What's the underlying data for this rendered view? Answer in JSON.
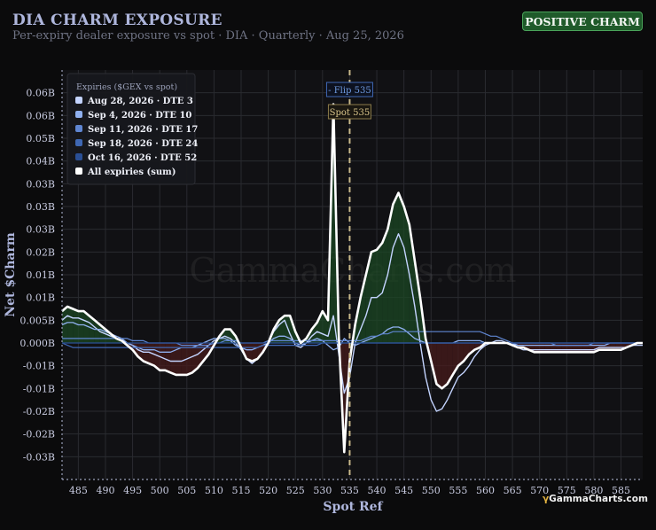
{
  "header": {
    "title": "DIA CHARM EXPOSURE",
    "subtitle": "Per-expiry dealer exposure vs spot · DIA · Quarterly · Aug 25, 2026",
    "badge": "POSITIVE CHARM"
  },
  "watermark": "GammaCharts.com",
  "brand": "GammaCharts.com",
  "colors": {
    "background": "#0b0b0c",
    "sum_line": "#ffffff",
    "positive_fill": "#1b4a24",
    "negative_fill": "#4a1b1b",
    "spot_line": "#c9b98a",
    "flip_label": "#6f9be0",
    "badge_bg": "#1f5a2a"
  },
  "chart_data": {
    "type": "line",
    "title": "DIA CHARM EXPOSURE",
    "xlabel": "Spot Ref",
    "ylabel": "Net $Charm",
    "xlim": [
      482,
      589
    ],
    "ylim": [
      -0.06,
      0.12
    ],
    "grid": true,
    "legend_title": "Expiries ($GEX vs spot)",
    "legend_position": "top-left",
    "x_ticks": [
      485,
      490,
      495,
      500,
      505,
      510,
      515,
      520,
      525,
      530,
      535,
      540,
      545,
      550,
      555,
      560,
      565,
      570,
      575,
      580,
      585
    ],
    "y_ticks": [
      {
        "v": -0.05,
        "label": "-0.03B"
      },
      {
        "v": -0.04,
        "label": "-0.02B"
      },
      {
        "v": -0.03,
        "label": "-0.02B"
      },
      {
        "v": -0.02,
        "label": "-0.01B"
      },
      {
        "v": -0.01,
        "label": "-0.01B"
      },
      {
        "v": 0.0,
        "label": "0.000B"
      },
      {
        "v": 0.01,
        "label": "0.005B"
      },
      {
        "v": 0.02,
        "label": "0.01B"
      },
      {
        "v": 0.03,
        "label": "0.01B"
      },
      {
        "v": 0.04,
        "label": "0.02B"
      },
      {
        "v": 0.05,
        "label": "0.03B"
      },
      {
        "v": 0.06,
        "label": "0.03B"
      },
      {
        "v": 0.07,
        "label": "0.03B"
      },
      {
        "v": 0.08,
        "label": "0.04B"
      },
      {
        "v": 0.09,
        "label": "0.05B"
      },
      {
        "v": 0.1,
        "label": "0.06B"
      },
      {
        "v": 0.11,
        "label": "0.06B"
      }
    ],
    "spot": 535,
    "spot_label": "Spot 535",
    "flip": 535,
    "flip_label": "- Flip 535",
    "x": [
      482,
      483,
      484,
      485,
      486,
      487,
      488,
      489,
      490,
      491,
      492,
      493,
      494,
      495,
      496,
      497,
      498,
      499,
      500,
      501,
      502,
      503,
      504,
      505,
      506,
      507,
      508,
      509,
      510,
      511,
      512,
      513,
      514,
      515,
      516,
      517,
      518,
      519,
      520,
      521,
      522,
      523,
      524,
      525,
      526,
      527,
      528,
      529,
      530,
      531,
      532,
      533,
      534,
      535,
      536,
      537,
      538,
      539,
      540,
      541,
      542,
      543,
      544,
      545,
      546,
      547,
      548,
      549,
      550,
      551,
      552,
      553,
      554,
      555,
      556,
      557,
      558,
      559,
      560,
      561,
      562,
      563,
      564,
      565,
      566,
      567,
      568,
      569,
      570,
      571,
      572,
      573,
      574,
      575,
      576,
      577,
      578,
      579,
      580,
      581,
      582,
      583,
      584,
      585,
      586,
      587,
      588,
      589
    ],
    "series": [
      {
        "name": "Aug 28, 2026 · DTE 3",
        "color": "#c4d4ff",
        "width": 1.4,
        "values": [
          0.01,
          0.012,
          0.011,
          0.011,
          0.01,
          0.009,
          0.007,
          0.005,
          0.004,
          0.003,
          0.002,
          0.001,
          0.0,
          -0.001,
          -0.003,
          -0.004,
          -0.004,
          -0.005,
          -0.006,
          -0.007,
          -0.008,
          -0.008,
          -0.008,
          -0.007,
          -0.006,
          -0.005,
          -0.003,
          -0.001,
          0.001,
          0.002,
          0.003,
          0.002,
          0.0,
          -0.003,
          -0.007,
          -0.009,
          -0.007,
          -0.004,
          0.0,
          0.005,
          0.008,
          0.01,
          0.004,
          -0.001,
          -0.002,
          0.0,
          0.003,
          0.005,
          0.004,
          0.003,
          0.012,
          -0.005,
          -0.022,
          -0.015,
          0.0,
          0.006,
          0.012,
          0.02,
          0.02,
          0.022,
          0.03,
          0.042,
          0.048,
          0.042,
          0.03,
          0.016,
          0.0,
          -0.015,
          -0.025,
          -0.03,
          -0.029,
          -0.025,
          -0.02,
          -0.015,
          -0.013,
          -0.01,
          -0.006,
          -0.003,
          -0.001,
          0.0,
          0.001,
          0.001,
          0.0,
          0.0,
          -0.002,
          -0.003,
          -0.003,
          -0.003,
          -0.003,
          -0.003,
          -0.003,
          -0.003,
          -0.003,
          -0.003,
          -0.003,
          -0.003,
          -0.003,
          -0.003,
          -0.003,
          -0.002,
          -0.002,
          -0.002,
          -0.002,
          -0.002,
          -0.002,
          -0.001,
          -0.001,
          -0.001
        ]
      },
      {
        "name": "Sep 4, 2026 · DTE 10",
        "color": "#8fb0ef",
        "width": 1.3,
        "values": [
          0.008,
          0.009,
          0.009,
          0.008,
          0.008,
          0.007,
          0.006,
          0.006,
          0.005,
          0.004,
          0.003,
          0.002,
          0.0,
          -0.001,
          -0.002,
          -0.003,
          -0.003,
          -0.003,
          -0.004,
          -0.004,
          -0.004,
          -0.003,
          -0.002,
          -0.002,
          -0.002,
          -0.001,
          0.0,
          0.001,
          0.002,
          0.002,
          0.002,
          0.001,
          -0.001,
          -0.002,
          -0.003,
          -0.003,
          -0.002,
          -0.001,
          0.0,
          0.002,
          0.003,
          0.003,
          0.002,
          0.0,
          -0.001,
          0.0,
          0.001,
          0.002,
          0.001,
          -0.001,
          -0.003,
          -0.002,
          0.002,
          0.0,
          -0.001,
          0.0,
          0.001,
          0.002,
          0.003,
          0.004,
          0.006,
          0.007,
          0.007,
          0.006,
          0.004,
          0.002,
          0.001,
          0.0,
          0.0,
          0.0,
          0.0,
          0.0,
          0.0,
          0.001,
          0.001,
          0.001,
          0.001,
          0.001,
          0.0,
          0.0,
          0.0,
          0.0,
          0.0,
          0.0,
          -0.001,
          -0.001,
          -0.001,
          -0.001,
          -0.001,
          -0.001,
          -0.001,
          -0.001,
          -0.001,
          -0.001,
          -0.001,
          -0.001,
          -0.001,
          -0.001,
          -0.001,
          -0.001,
          -0.001,
          0.0,
          0.0,
          0.0,
          0.0,
          0.0,
          0.0,
          0.0
        ]
      },
      {
        "name": "Sep 11, 2026 · DTE 17",
        "color": "#5f86d2",
        "width": 1.2,
        "values": [
          0.002,
          0.002,
          0.002,
          0.002,
          0.002,
          0.002,
          0.002,
          0.002,
          0.002,
          0.002,
          0.002,
          0.002,
          0.002,
          0.001,
          0.001,
          0.001,
          0.0,
          0.0,
          0.0,
          0.0,
          0.0,
          0.0,
          -0.001,
          -0.001,
          -0.001,
          -0.001,
          -0.001,
          -0.001,
          0.0,
          0.0,
          0.001,
          0.001,
          0.001,
          0.0,
          0.0,
          0.0,
          0.0,
          0.0,
          0.001,
          0.001,
          0.001,
          0.001,
          0.001,
          0.001,
          0.001,
          0.001,
          0.001,
          0.001,
          0.001,
          0.001,
          0.001,
          0.001,
          0.001,
          0.001,
          0.001,
          0.001,
          0.002,
          0.003,
          0.003,
          0.004,
          0.004,
          0.005,
          0.005,
          0.005,
          0.005,
          0.005,
          0.005,
          0.005,
          0.005,
          0.005,
          0.005,
          0.005,
          0.005,
          0.005,
          0.005,
          0.005,
          0.005,
          0.005,
          0.004,
          0.003,
          0.003,
          0.002,
          0.001,
          0.0,
          0.0,
          0.0,
          0.0,
          0.0,
          0.0,
          0.0,
          0.0,
          -0.001,
          -0.001,
          -0.001,
          -0.001,
          -0.001,
          -0.001,
          -0.001,
          0.0,
          0.0,
          0.0,
          0.0,
          0.0,
          0.0,
          0.0,
          0.0,
          0.0,
          0.0
        ]
      },
      {
        "name": "Sep 18, 2026 · DTE 24",
        "color": "#3f68b4",
        "width": 1.2,
        "values": [
          0.0,
          -0.001,
          -0.002,
          -0.002,
          -0.002,
          -0.002,
          -0.002,
          -0.002,
          -0.002,
          -0.002,
          -0.002,
          -0.002,
          -0.002,
          -0.002,
          -0.002,
          -0.002,
          -0.002,
          -0.002,
          -0.002,
          -0.002,
          -0.002,
          -0.002,
          -0.002,
          -0.002,
          -0.002,
          -0.002,
          -0.002,
          -0.002,
          -0.002,
          -0.002,
          -0.002,
          -0.002,
          -0.002,
          -0.002,
          -0.002,
          -0.002,
          -0.002,
          -0.001,
          -0.001,
          -0.001,
          -0.001,
          -0.001,
          -0.001,
          -0.001,
          -0.001,
          -0.001,
          -0.001,
          -0.001,
          0.0,
          0.0,
          0.0,
          0.0,
          0.0,
          0.0,
          0.0,
          0.0,
          0.0,
          0.0,
          0.0,
          0.0,
          0.0,
          0.0,
          0.0,
          0.0,
          0.0,
          0.0,
          0.0,
          0.0,
          0.0,
          0.0,
          0.0,
          0.0,
          0.0,
          0.0,
          0.0,
          0.0,
          0.0,
          0.0,
          0.0,
          0.0,
          0.0,
          0.0,
          0.0,
          0.0,
          0.0,
          0.0,
          0.0,
          0.0,
          0.0,
          0.0,
          0.0,
          0.0,
          0.0,
          0.0,
          0.0,
          0.0,
          0.0,
          0.0,
          0.0,
          0.0,
          0.0,
          0.0,
          0.0,
          0.0,
          0.0,
          0.0,
          0.0,
          0.0
        ]
      },
      {
        "name": "Oct 16, 2026 · DTE 52",
        "color": "#2a4f95",
        "width": 1.2,
        "values": [
          0.0,
          0.0,
          0.0,
          0.0,
          0.0,
          0.0,
          0.0,
          0.0,
          0.0,
          0.0,
          0.0,
          0.0,
          0.0,
          0.0,
          0.0,
          0.0,
          0.0,
          0.0,
          0.0,
          0.0,
          0.0,
          0.0,
          0.0,
          0.0,
          0.0,
          0.0,
          0.0,
          0.0,
          0.0,
          0.0,
          0.0,
          0.0,
          0.0,
          0.0,
          0.0,
          0.0,
          0.0,
          0.0,
          0.0,
          0.0,
          0.0,
          0.0,
          0.0,
          0.0,
          0.0,
          0.0,
          0.0,
          0.0,
          0.0,
          0.0,
          0.0,
          0.0,
          0.0,
          0.0,
          0.0,
          0.0,
          0.0,
          0.0,
          0.0,
          0.0,
          0.0,
          0.0,
          0.0,
          0.0,
          0.0,
          0.0,
          0.0,
          0.0,
          0.0,
          0.0,
          0.0,
          0.0,
          0.0,
          0.0,
          0.0,
          0.0,
          0.0,
          0.0,
          0.0,
          0.0,
          0.0,
          0.0,
          0.0,
          0.0,
          0.0,
          0.0,
          0.0,
          0.0,
          0.0,
          0.0,
          0.0,
          0.0,
          0.0,
          0.0,
          0.0,
          0.0,
          0.0,
          0.0,
          0.0,
          0.0,
          0.0,
          0.0,
          0.0,
          0.0,
          0.0,
          0.0,
          0.0,
          0.0
        ]
      },
      {
        "name": "All expiries (sum)",
        "color": "#ffffff",
        "width": 2.6,
        "fill": true,
        "values": [
          0.014,
          0.016,
          0.015,
          0.014,
          0.014,
          0.012,
          0.01,
          0.008,
          0.006,
          0.004,
          0.002,
          0.001,
          -0.001,
          -0.003,
          -0.006,
          -0.008,
          -0.009,
          -0.01,
          -0.012,
          -0.012,
          -0.013,
          -0.014,
          -0.014,
          -0.014,
          -0.013,
          -0.011,
          -0.008,
          -0.005,
          -0.001,
          0.003,
          0.006,
          0.006,
          0.003,
          -0.002,
          -0.007,
          -0.008,
          -0.007,
          -0.004,
          0.0,
          0.006,
          0.01,
          0.012,
          0.012,
          0.005,
          0.0,
          0.002,
          0.006,
          0.009,
          0.014,
          0.01,
          0.105,
          0.003,
          -0.048,
          -0.008,
          0.008,
          0.02,
          0.03,
          0.04,
          0.041,
          0.044,
          0.05,
          0.061,
          0.066,
          0.06,
          0.052,
          0.036,
          0.02,
          0.002,
          -0.008,
          -0.018,
          -0.02,
          -0.018,
          -0.014,
          -0.01,
          -0.008,
          -0.005,
          -0.003,
          -0.002,
          0.0,
          0.0,
          0.0,
          0.0,
          0.0,
          -0.001,
          -0.002,
          -0.002,
          -0.003,
          -0.004,
          -0.004,
          -0.004,
          -0.004,
          -0.004,
          -0.004,
          -0.004,
          -0.004,
          -0.004,
          -0.004,
          -0.004,
          -0.004,
          -0.003,
          -0.003,
          -0.003,
          -0.003,
          -0.003,
          -0.002,
          -0.001,
          0.0,
          0.0
        ]
      }
    ]
  }
}
